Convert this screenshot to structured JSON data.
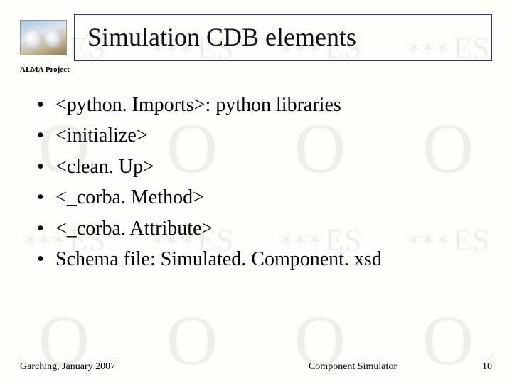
{
  "header": {
    "title": "Simulation CDB elements",
    "project_label": "ALMA Project"
  },
  "bullets": [
    "<python. Imports>: python libraries",
    "<initialize>",
    "<clean. Up>",
    "<_corba. Method>",
    "<_corba. Attribute>",
    "Schema file: Simulated. Component. xsd"
  ],
  "footer": {
    "left": "Garching, January 2007",
    "center": "Component Simulator",
    "page": "10"
  },
  "watermark": {
    "stars": "✶✶✶",
    "es": "ES",
    "o": "O"
  }
}
